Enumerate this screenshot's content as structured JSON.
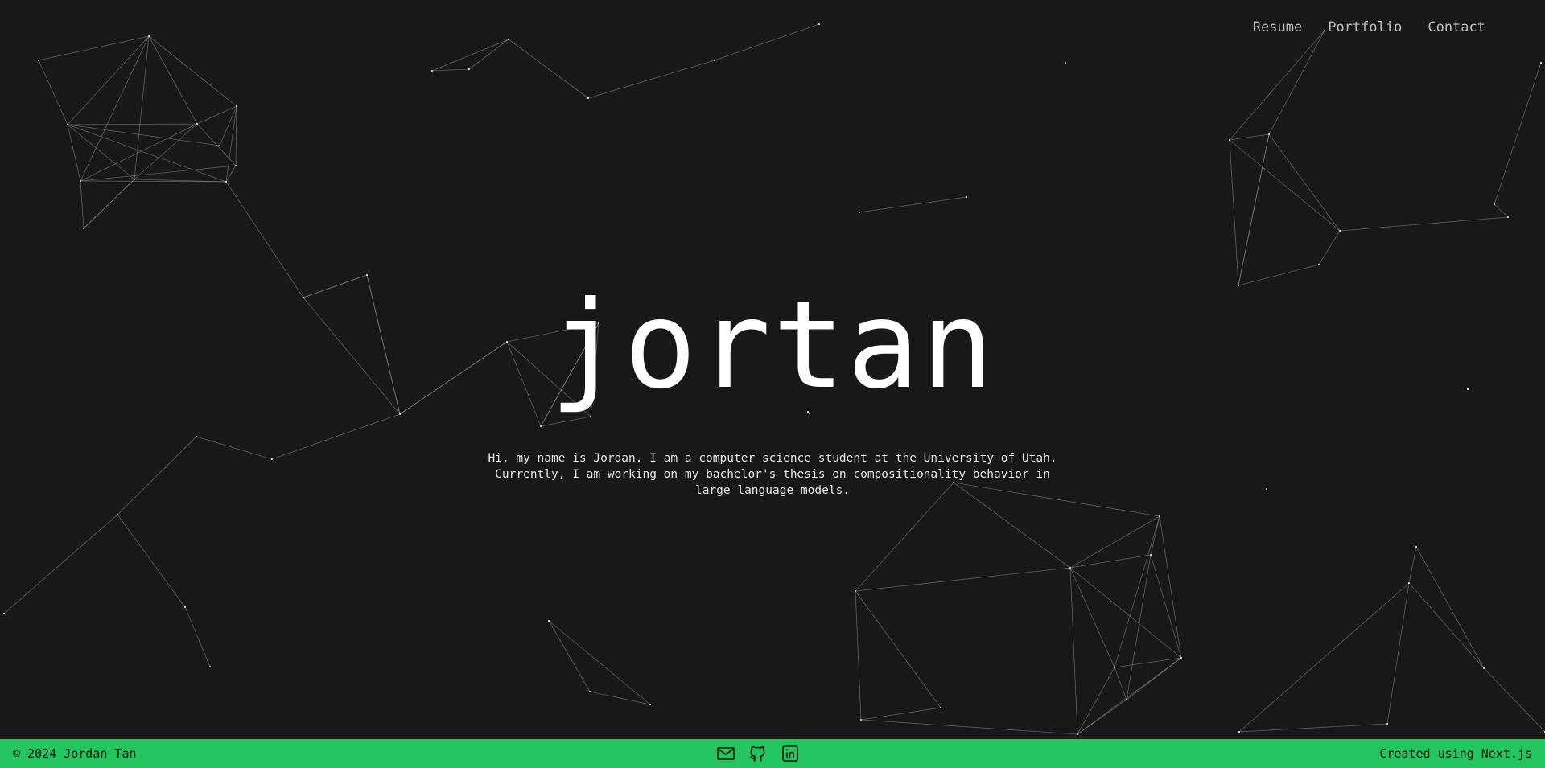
{
  "nav": {
    "items": [
      {
        "label": "Resume"
      },
      {
        "label": "Portfolio"
      },
      {
        "label": "Contact"
      }
    ]
  },
  "hero": {
    "title": "jortan",
    "description": "Hi, my name is Jordan. I am a computer science student at the University of Utah. Currently, I am working on my bachelor's thesis on compositionality behavior in large language models."
  },
  "footer": {
    "copyright": "© 2024 Jordan Tan",
    "credit": "Created using Next.js",
    "socials": [
      {
        "icon": "mail-icon"
      },
      {
        "icon": "github-icon"
      },
      {
        "icon": "linkedin-icon"
      }
    ]
  },
  "colors": {
    "background": "#181818",
    "footer": "#22c55e",
    "text": "#ffffff",
    "network": "#9a9a9a"
  }
}
